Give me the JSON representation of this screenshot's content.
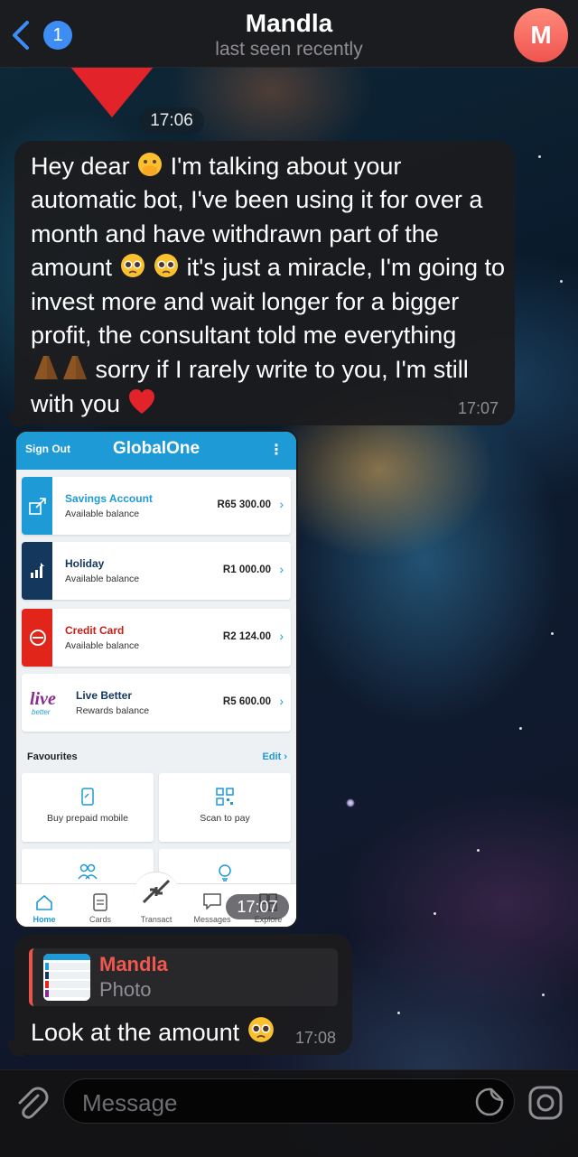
{
  "header": {
    "back_badge": "1",
    "title": "Mandla",
    "subtitle": "last seen recently",
    "avatar_letter": "M",
    "avatar_colors": [
      "#ff8a7a",
      "#f0544f"
    ]
  },
  "date_pill": "17:06",
  "messages": [
    {
      "text_parts": [
        "Hey dear ",
        " I'm talking about your automatic bot, I've been using it for over a month and have withdrawn part of the amount ",
        " ",
        " it's just a miracle, I'm going to invest more and wait longer for a bigger profit, the consultant told me everything ",
        " sorry if I rarely write to you, I'm still with you "
      ],
      "emojis": [
        "face-with-hand-over-mouth",
        "pleading-face",
        "pleading-face",
        "folded-hands",
        "red-heart"
      ],
      "time": "17:07"
    },
    {
      "type": "photo",
      "time": "17:07",
      "screenshot": {
        "signout": "Sign Out",
        "logo": "GlobalOne",
        "accounts": [
          {
            "name": "Savings Account",
            "sub": "Available balance",
            "amount": "R65 300.00",
            "color": "#1e9ad6",
            "icon": "transfer-icon"
          },
          {
            "name": "Holiday",
            "sub": "Available balance",
            "amount": "R1 000.00",
            "color": "#14375e",
            "icon": "growth-chart-icon"
          },
          {
            "name": "Credit Card",
            "sub": "Available balance",
            "amount": "R2 124.00",
            "color": "#e1251b",
            "icon": "card-logo-icon"
          },
          {
            "name": "Live Better",
            "sub": "Rewards balance",
            "amount": "R5 600.00",
            "color": "#ffffff",
            "icon": "live-better-logo"
          }
        ],
        "favourites_title": "Favourites",
        "favourites_edit": "Edit",
        "favourites": [
          {
            "label": "Buy prepaid mobile",
            "icon": "mobile-icon"
          },
          {
            "label": "Scan to pay",
            "icon": "qr-icon"
          },
          {
            "label": "",
            "icon": "people-icon"
          },
          {
            "label": "",
            "icon": "bulb-icon"
          }
        ],
        "tabs": [
          "Home",
          "Cards",
          "Transact",
          "Messages",
          "Explore"
        ]
      }
    },
    {
      "reply_to": {
        "name": "Mandla",
        "type": "Photo"
      },
      "text": "Look at the amount ",
      "emoji": "pleading-face",
      "time": "17:08"
    }
  ],
  "input": {
    "placeholder": "Message"
  },
  "colors": {
    "accent": "#3d8df5",
    "bubble": "#1c1c1e",
    "reply_accent": "#e8564b"
  }
}
